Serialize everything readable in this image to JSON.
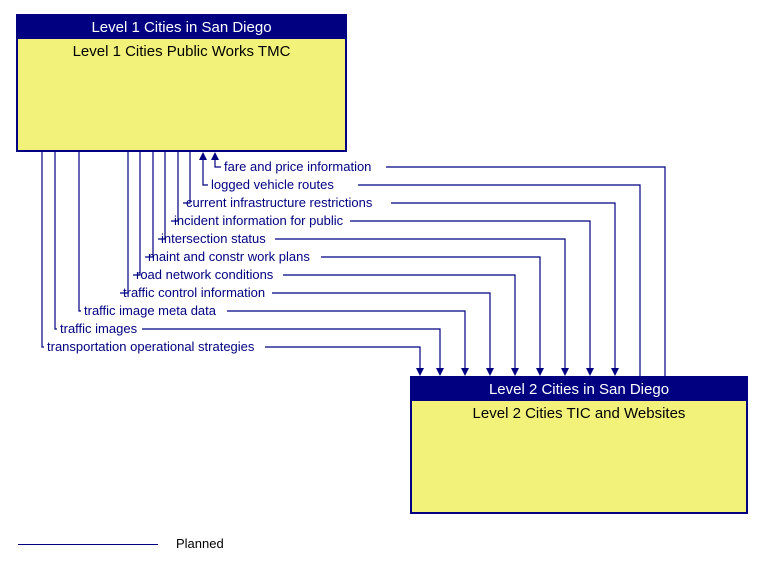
{
  "boxes": {
    "top": {
      "header": "Level 1 Cities in San Diego",
      "title": "Level 1 Cities Public Works TMC"
    },
    "bottom": {
      "header": "Level 2 Cities in San Diego",
      "title": "Level 2 Cities TIC and Websites"
    }
  },
  "flows": {
    "f1": "fare and price information",
    "f2": "logged vehicle routes",
    "f3": "current infrastructure restrictions",
    "f4": "incident information for public",
    "f5": "intersection status",
    "f6": "maint and constr work plans",
    "f7": "road network conditions",
    "f8": "traffic control information",
    "f9": "traffic image meta data",
    "f10": "traffic images",
    "f11": "transportation operational strategies"
  },
  "legend": {
    "planned": "Planned"
  }
}
